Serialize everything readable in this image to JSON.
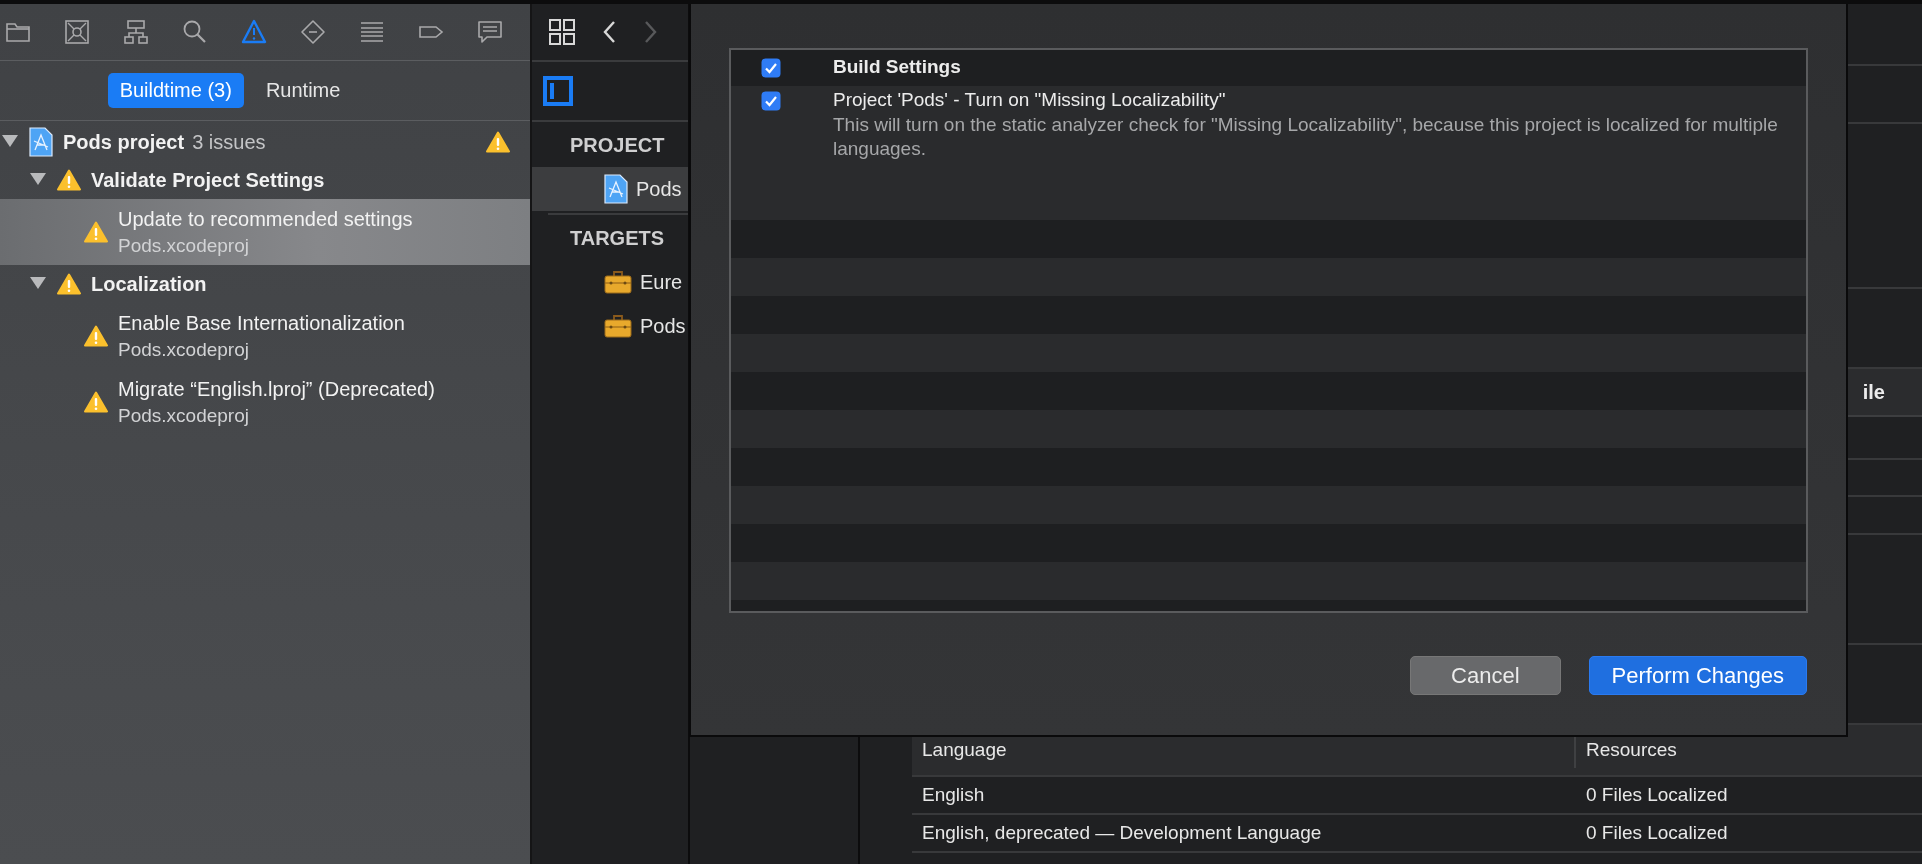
{
  "navigator": {
    "tabs": [
      {
        "selected": false
      },
      {
        "selected": false
      },
      {
        "selected": false
      },
      {
        "selected": false
      },
      {
        "selected": true
      },
      {
        "selected": false
      },
      {
        "selected": false
      },
      {
        "selected": false
      },
      {
        "selected": false
      }
    ],
    "segments": [
      {
        "label": "Buildtime (3)",
        "selected": true
      },
      {
        "label": "Runtime",
        "selected": false
      }
    ],
    "issues": [
      {
        "kind": "project",
        "title": "Pods project",
        "detail": "3 issues",
        "expanded": true,
        "selected": false,
        "children": [
          {
            "kind": "group",
            "title": "Validate Project Settings",
            "expanded": true,
            "selected": false,
            "children": [
              {
                "kind": "issue",
                "title": "Update to recommended settings",
                "subtitle": "Pods.xcodeproj",
                "selected": true
              }
            ]
          },
          {
            "kind": "group",
            "title": "Localization",
            "expanded": true,
            "selected": false,
            "children": [
              {
                "kind": "issue",
                "title": "Enable Base Internationalization",
                "subtitle": "Pods.xcodeproj",
                "selected": false
              },
              {
                "kind": "issue",
                "title": "Migrate “English.lproj” (Deprecated)",
                "subtitle": "Pods.xcodeproj",
                "selected": false
              }
            ]
          }
        ]
      }
    ]
  },
  "project_list": {
    "nav": [
      {
        "kind": "back",
        "disabled": false
      },
      {
        "kind": "forward",
        "disabled": true
      }
    ],
    "sections": [
      {
        "heading": "PROJECT",
        "items": [
          {
            "kind": "project",
            "label": "Pods",
            "selected": true
          }
        ]
      },
      {
        "heading": "TARGETS",
        "items": [
          {
            "kind": "target",
            "label": "Eure",
            "selected": false
          },
          {
            "kind": "target",
            "label": "Pods",
            "selected": false
          }
        ]
      }
    ]
  },
  "editor": {
    "column_header": "ile",
    "localizations": {
      "columns": [
        "Language",
        "Resources"
      ],
      "rows": [
        [
          "English",
          "0 Files Localized"
        ],
        [
          "English, deprecated — Development Language",
          "0 Files Localized"
        ]
      ]
    }
  },
  "sheet": {
    "changes": [
      {
        "kind": "group",
        "title": "Build Settings",
        "checked": true
      },
      {
        "kind": "change",
        "title": "Project 'Pods' - Turn on \"Missing Localizability\"",
        "description": "This will turn on the static analyzer check for \"Missing Localizability\", because this project is localized for multiple languages.",
        "checked": true
      }
    ],
    "buttons": [
      {
        "kind": "secondary",
        "label": "Cancel"
      },
      {
        "kind": "primary",
        "label": "Perform Changes"
      }
    ]
  }
}
